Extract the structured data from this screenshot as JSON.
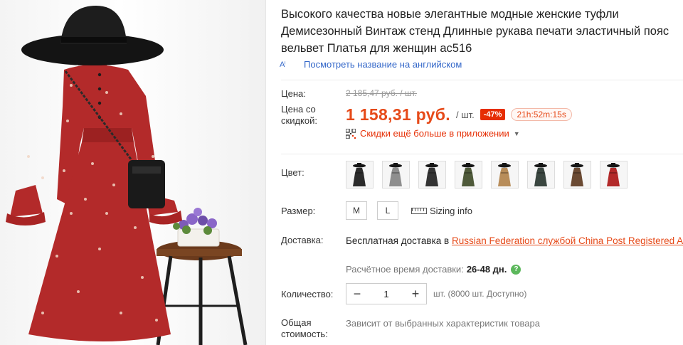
{
  "product": {
    "title": "Высокого качества новые элегантные модные женские туфли Демисезонный Винтаж стенд Длинные рукава печати эластичный пояс вельвет Платья для женщин ac516",
    "translate_icon": "A",
    "translate_link": "Посмотреть название на английском"
  },
  "price": {
    "label": "Цена:",
    "original": "2 185,47 руб. / шт.",
    "discount_label": "Цена со скидкой:",
    "discounted": "1 158,31 руб.",
    "unit": "/ шт.",
    "discount_badge": "-47%",
    "timer": "21h:52m:15s",
    "app_deals": "Скидки ещё больше в приложении",
    "app_deals_icon": "qr-code-icon"
  },
  "color": {
    "label": "Цвет:",
    "swatches": [
      {
        "name": "black",
        "hex": "#2b2b2b"
      },
      {
        "name": "gray",
        "hex": "#8e8e8e"
      },
      {
        "name": "black-print",
        "hex": "#333333"
      },
      {
        "name": "olive",
        "hex": "#4f5a3a"
      },
      {
        "name": "khaki",
        "hex": "#b88d5a"
      },
      {
        "name": "dark-green",
        "hex": "#3a4640"
      },
      {
        "name": "brown",
        "hex": "#6b4a33"
      },
      {
        "name": "red",
        "hex": "#b32a2a"
      }
    ]
  },
  "size": {
    "label": "Размер:",
    "options": [
      "M",
      "L"
    ],
    "sizing_info": "Sizing info",
    "sizing_icon": "ruler-icon"
  },
  "delivery": {
    "label": "Доставка:",
    "text_prefix": "Бесплатная доставка в",
    "link_text": "Russian Federation службой China Post Registered Air Mail",
    "eta_label": "Расчётное время доставки:",
    "eta_value": "26-48 дн.",
    "help_icon": "question-icon"
  },
  "quantity": {
    "label": "Количество:",
    "value": "1",
    "minus": "−",
    "plus": "+",
    "availability": "шт. (8000 шт. Доступно)"
  },
  "total": {
    "label": "Общая стоимость:",
    "value": "Зависит от выбранных характеристик товара"
  },
  "colors": {
    "accent": "#e64a19",
    "badge": "#e62e04",
    "link": "#3367c9",
    "dress": "#b32a2a"
  }
}
